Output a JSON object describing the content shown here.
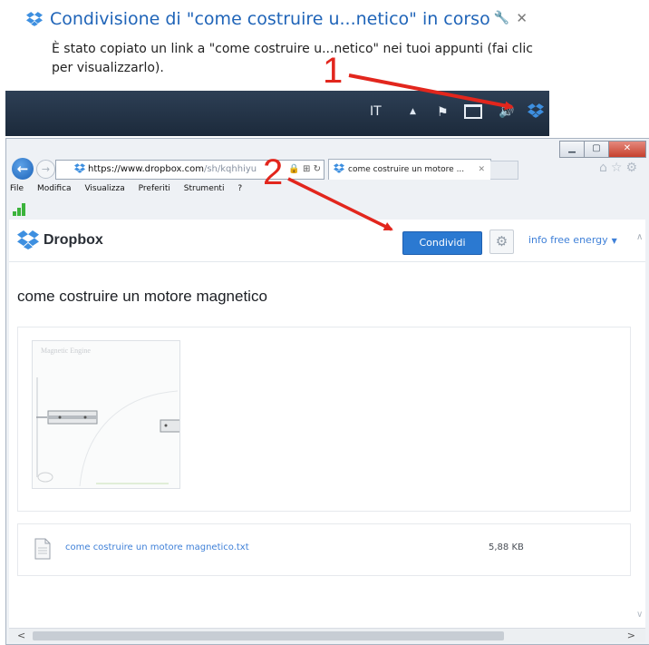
{
  "notification": {
    "title": "Condivisione di \"come costruire u...netico\" in corso",
    "message": "È stato copiato un link a \"come costruire u...netico\" nei tuoi appunti (fai clic per visualizzarlo).",
    "icons": [
      "dropbox-icon",
      "wrench-icon",
      "close-icon"
    ]
  },
  "taskbar": {
    "language": "IT",
    "icons": [
      "show-hidden-icons",
      "flag-icon",
      "network-icon",
      "volume-icon",
      "dropbox-icon"
    ]
  },
  "annotations": {
    "step1": "1",
    "step2": "2",
    "arrow_color": "#e2261d"
  },
  "browser": {
    "url_host": "https://www.dropbox.com",
    "url_rest": "/sh/kqhhiyu",
    "tab_title": "come costruire un motore ...",
    "menu": [
      "File",
      "Modifica",
      "Visualizza",
      "Preferiti",
      "Strumenti",
      "?"
    ]
  },
  "dropbox": {
    "logo_text": "Dropbox",
    "share_label": "Condividi",
    "account_label": "info free energy",
    "file_title": "come costruire un motore magnetico",
    "preview_title": "Magnetic Engine",
    "file_name": "come costruire un motore magnetico.txt",
    "file_size": "5,88 KB",
    "brand_color": "#2b79d1"
  }
}
